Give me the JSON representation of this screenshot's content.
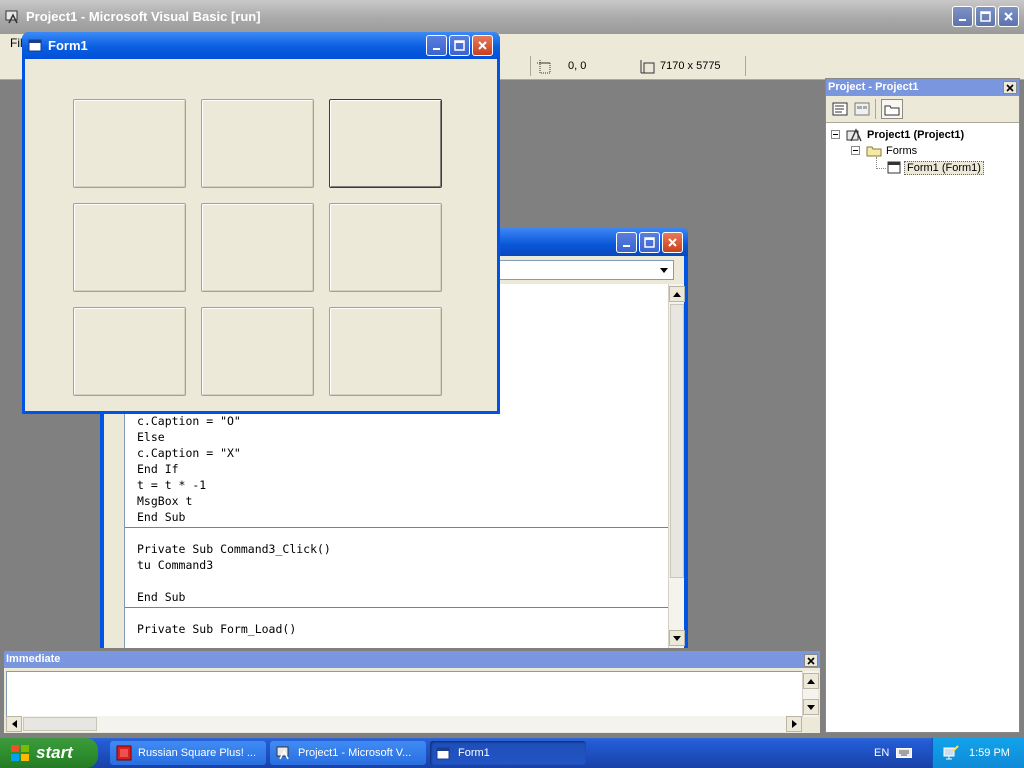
{
  "ide": {
    "title": "Project1 - Microsoft Visual Basic [run]",
    "menu_first": "File",
    "toolbar": {
      "position": "0, 0",
      "size": "7170 x 5775"
    }
  },
  "project_explorer": {
    "title": "Project - Project1",
    "tree": {
      "project": "Project1 (Project1)",
      "folder": "Forms",
      "form": "Form1 (Form1)"
    }
  },
  "code_window": {
    "lines_proc1": [
      "c.Caption = \"O\"",
      "Else",
      "c.Caption = \"X\"",
      "End If",
      "t = t * -1",
      "MsgBox t",
      "End Sub"
    ],
    "lines_proc2": [
      "Private Sub Command3_Click()",
      "tu Command3",
      "",
      "End Sub"
    ],
    "lines_proc3": [
      "Private Sub Form_Load()"
    ]
  },
  "form1": {
    "title": "Form1",
    "buttons": [
      {
        "caption": ""
      },
      {
        "caption": ""
      },
      {
        "caption": ""
      },
      {
        "caption": ""
      },
      {
        "caption": ""
      },
      {
        "caption": ""
      },
      {
        "caption": ""
      },
      {
        "caption": ""
      },
      {
        "caption": ""
      }
    ]
  },
  "immediate": {
    "title": "Immediate"
  },
  "taskbar": {
    "start": "start",
    "tasks": [
      {
        "label": "Russian Square Plus! ..."
      },
      {
        "label": "Project1 - Microsoft V..."
      },
      {
        "label": "Form1"
      }
    ],
    "language": "EN",
    "clock": "1:59 PM"
  },
  "icons": [
    "vb-app-icon",
    "form-icon",
    "minimize-icon",
    "maximize-icon",
    "close-icon",
    "project-icon",
    "folder-icon",
    "form-item-icon",
    "windows-logo-icon",
    "keyboard-icon",
    "network-icon"
  ]
}
